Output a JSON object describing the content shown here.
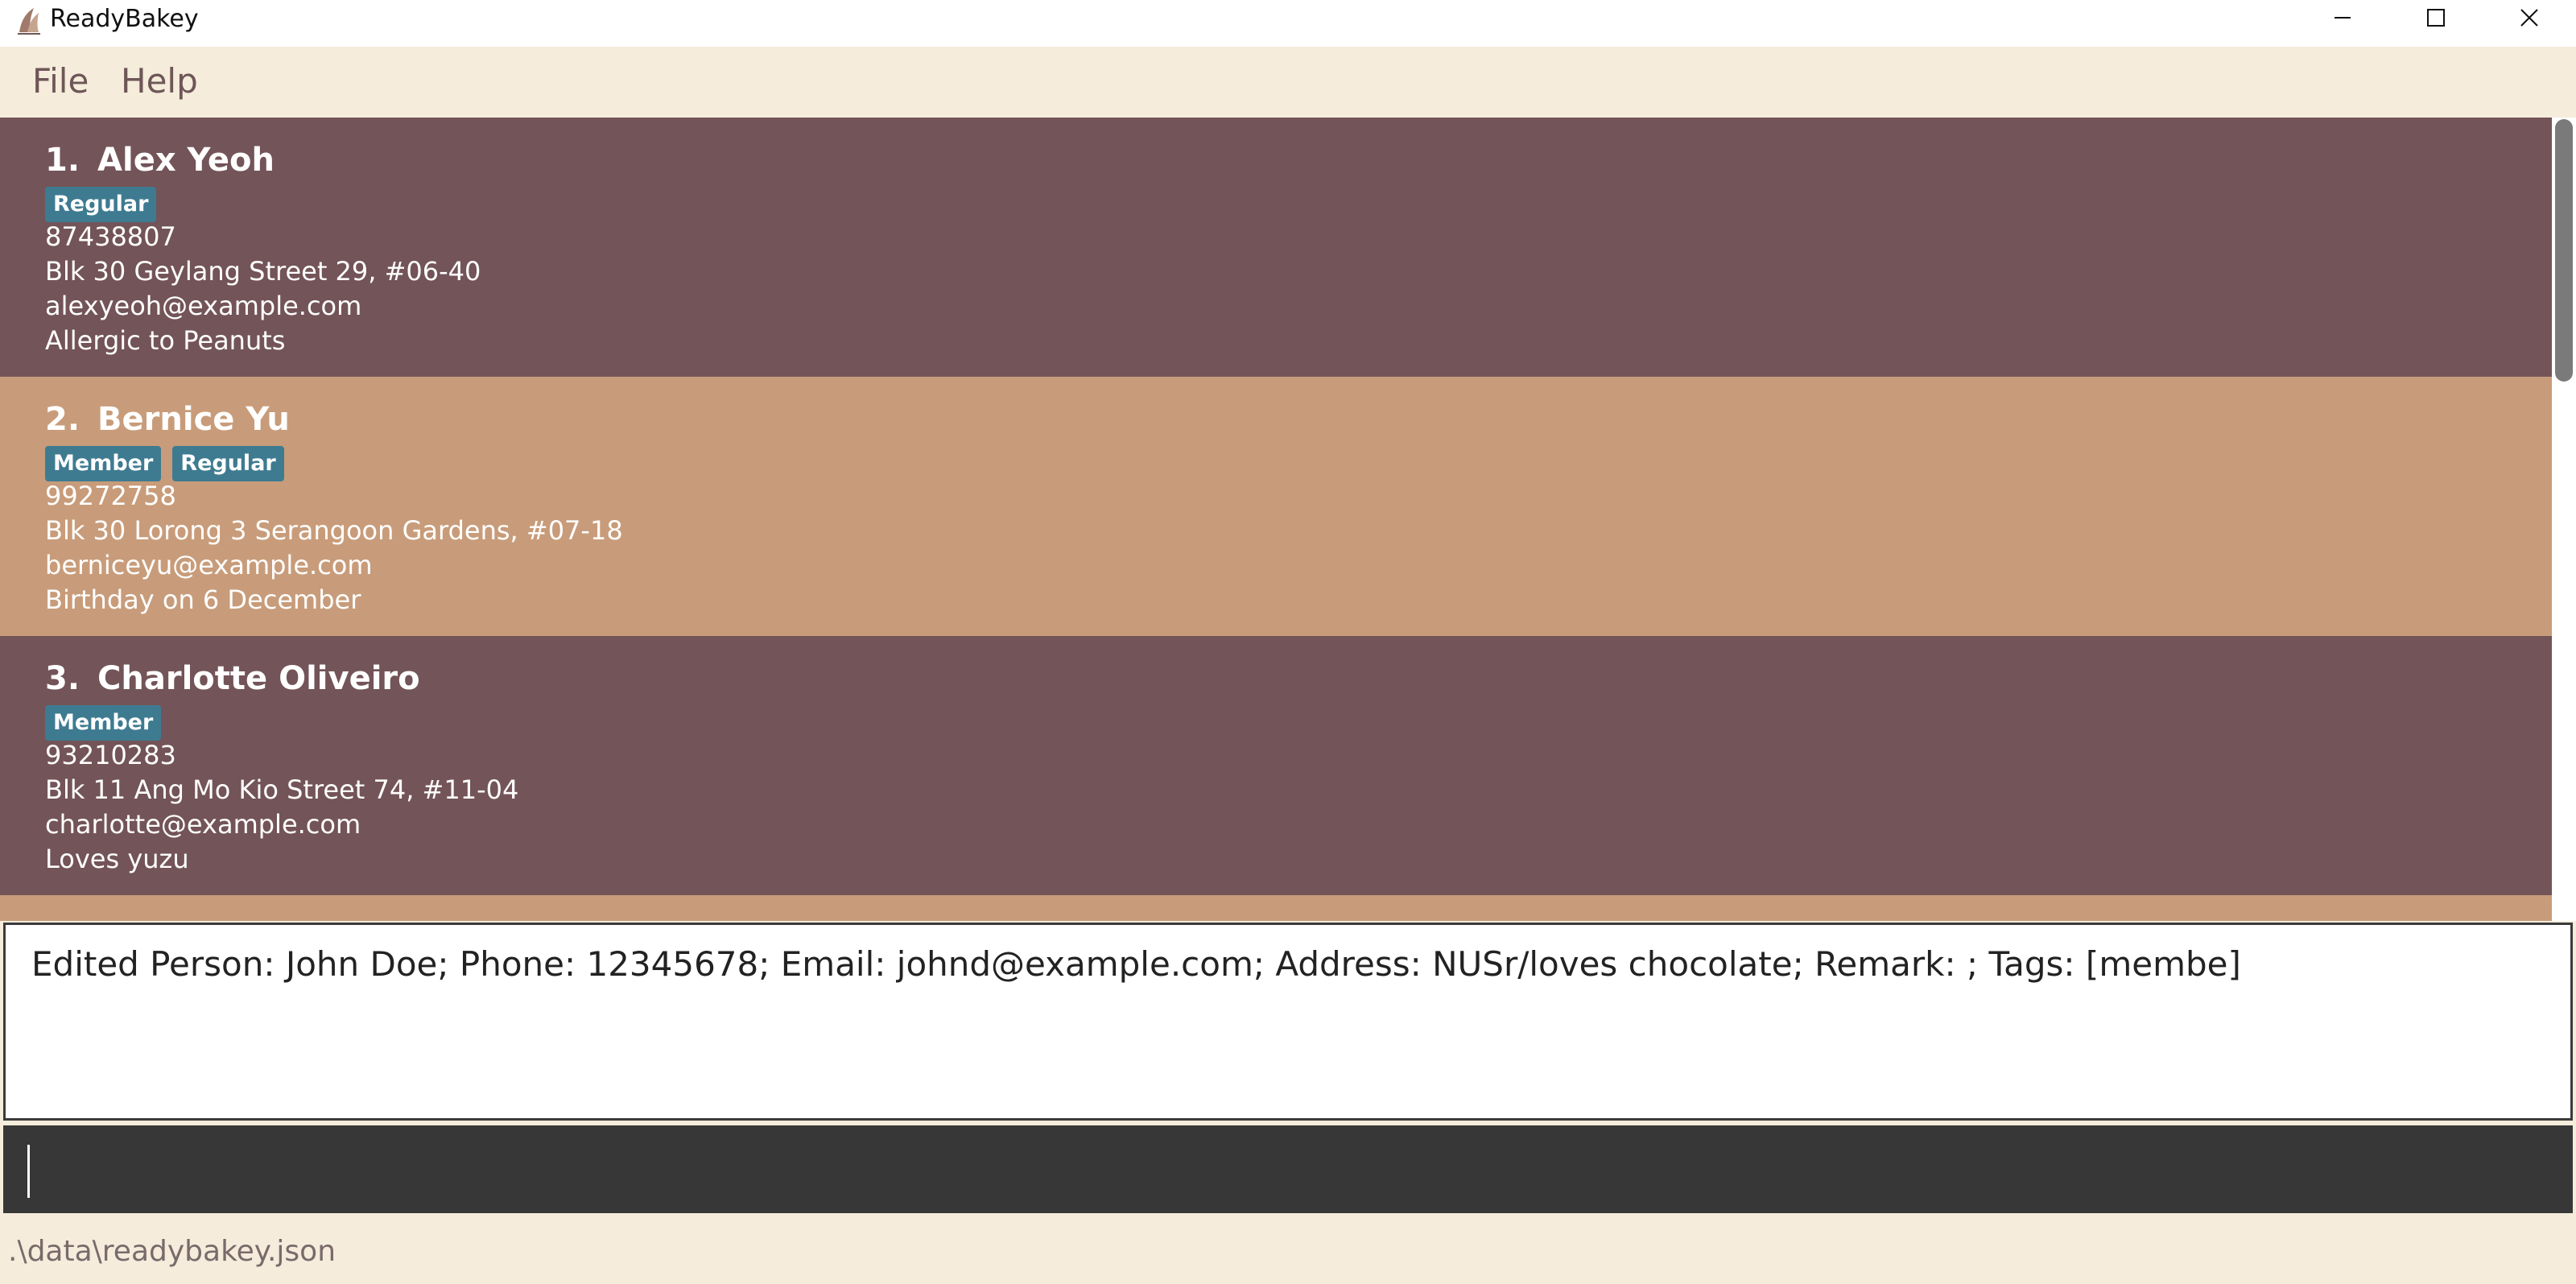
{
  "window": {
    "title": "ReadyBakey",
    "app_icon": "baker-logo-icon",
    "controls": [
      "minimize-icon",
      "maximize-icon",
      "close-icon"
    ]
  },
  "menu": {
    "file": "File",
    "help": "Help"
  },
  "persons": [
    {
      "index": "1.",
      "name": "Alex Yeoh",
      "tags": [
        "Regular"
      ],
      "phone": "87438807",
      "address": "Blk 30 Geylang Street 29, #06-40",
      "email": "alexyeoh@example.com",
      "remark": "Allergic to Peanuts"
    },
    {
      "index": "2.",
      "name": "Bernice Yu",
      "tags": [
        "Member",
        "Regular"
      ],
      "phone": "99272758",
      "address": "Blk 30 Lorong 3 Serangoon Gardens, #07-18",
      "email": "berniceyu@example.com",
      "remark": "Birthday on 6 December"
    },
    {
      "index": "3.",
      "name": "Charlotte Oliveiro",
      "tags": [
        "Member"
      ],
      "phone": "93210283",
      "address": "Blk 11 Ang Mo Kio Street 74, #11-04",
      "email": "charlotte@example.com",
      "remark": "Loves yuzu"
    }
  ],
  "result": {
    "text": "Edited Person: John Doe; Phone: 12345678; Email: johnd@example.com; Address: NUSr/loves chocolate; Remark: ; Tags: [membe]"
  },
  "command": {
    "value": ""
  },
  "status": {
    "path": ".\\data\\readybakey.json"
  },
  "colors": {
    "card_dark": "#735458",
    "card_light": "#c89c7a",
    "tag": "#3e7b91",
    "background": "#f5ecdc",
    "command_bg": "#373737"
  }
}
